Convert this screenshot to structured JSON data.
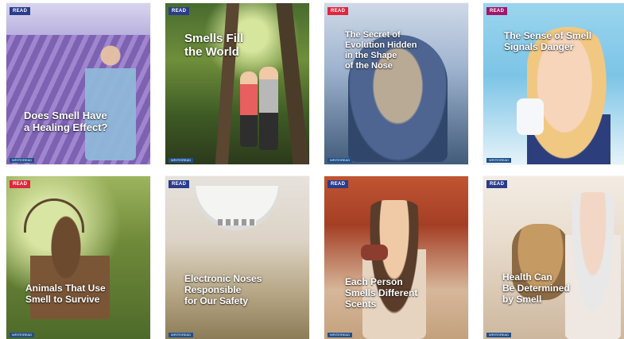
{
  "cards": [
    {
      "title": "Does Smell Have\na Healing Effect?",
      "badge": "READ",
      "badge_color": "#2b3c8a",
      "footer": "WRITE/READ"
    },
    {
      "title": "Smells Fill\nthe World",
      "badge": "READ",
      "badge_color": "#2b3c8a",
      "footer": "WRITE/READ"
    },
    {
      "title": "The Secret of\nEvolution Hidden\nin the Shape\nof the Nose",
      "badge": "READ",
      "badge_color": "#e0263c",
      "footer": "WRITE/READ"
    },
    {
      "title": "The Sense of Smell\nSignals Danger",
      "badge": "READ",
      "badge_color": "#a1166b",
      "footer": "WRITE/READ"
    },
    {
      "title": "Animals That Use\nSmell to Survive",
      "badge": "READ",
      "badge_color": "#e0263c",
      "footer": "WRITE/READ"
    },
    {
      "title": "Electronic Noses\nResponsible\nfor Our Safety",
      "badge": "READ",
      "badge_color": "#2b3c8a",
      "footer": "WRITE/READ"
    },
    {
      "title": "Each Person\nSmells Different\nScents",
      "badge": "READ",
      "badge_color": "#2b3c8a",
      "footer": "WRITE/READ"
    },
    {
      "title": "Health Can\nBe Determined\nby Smell",
      "badge": "READ",
      "badge_color": "#2b3c8a",
      "footer": "WRITE/READ"
    }
  ]
}
